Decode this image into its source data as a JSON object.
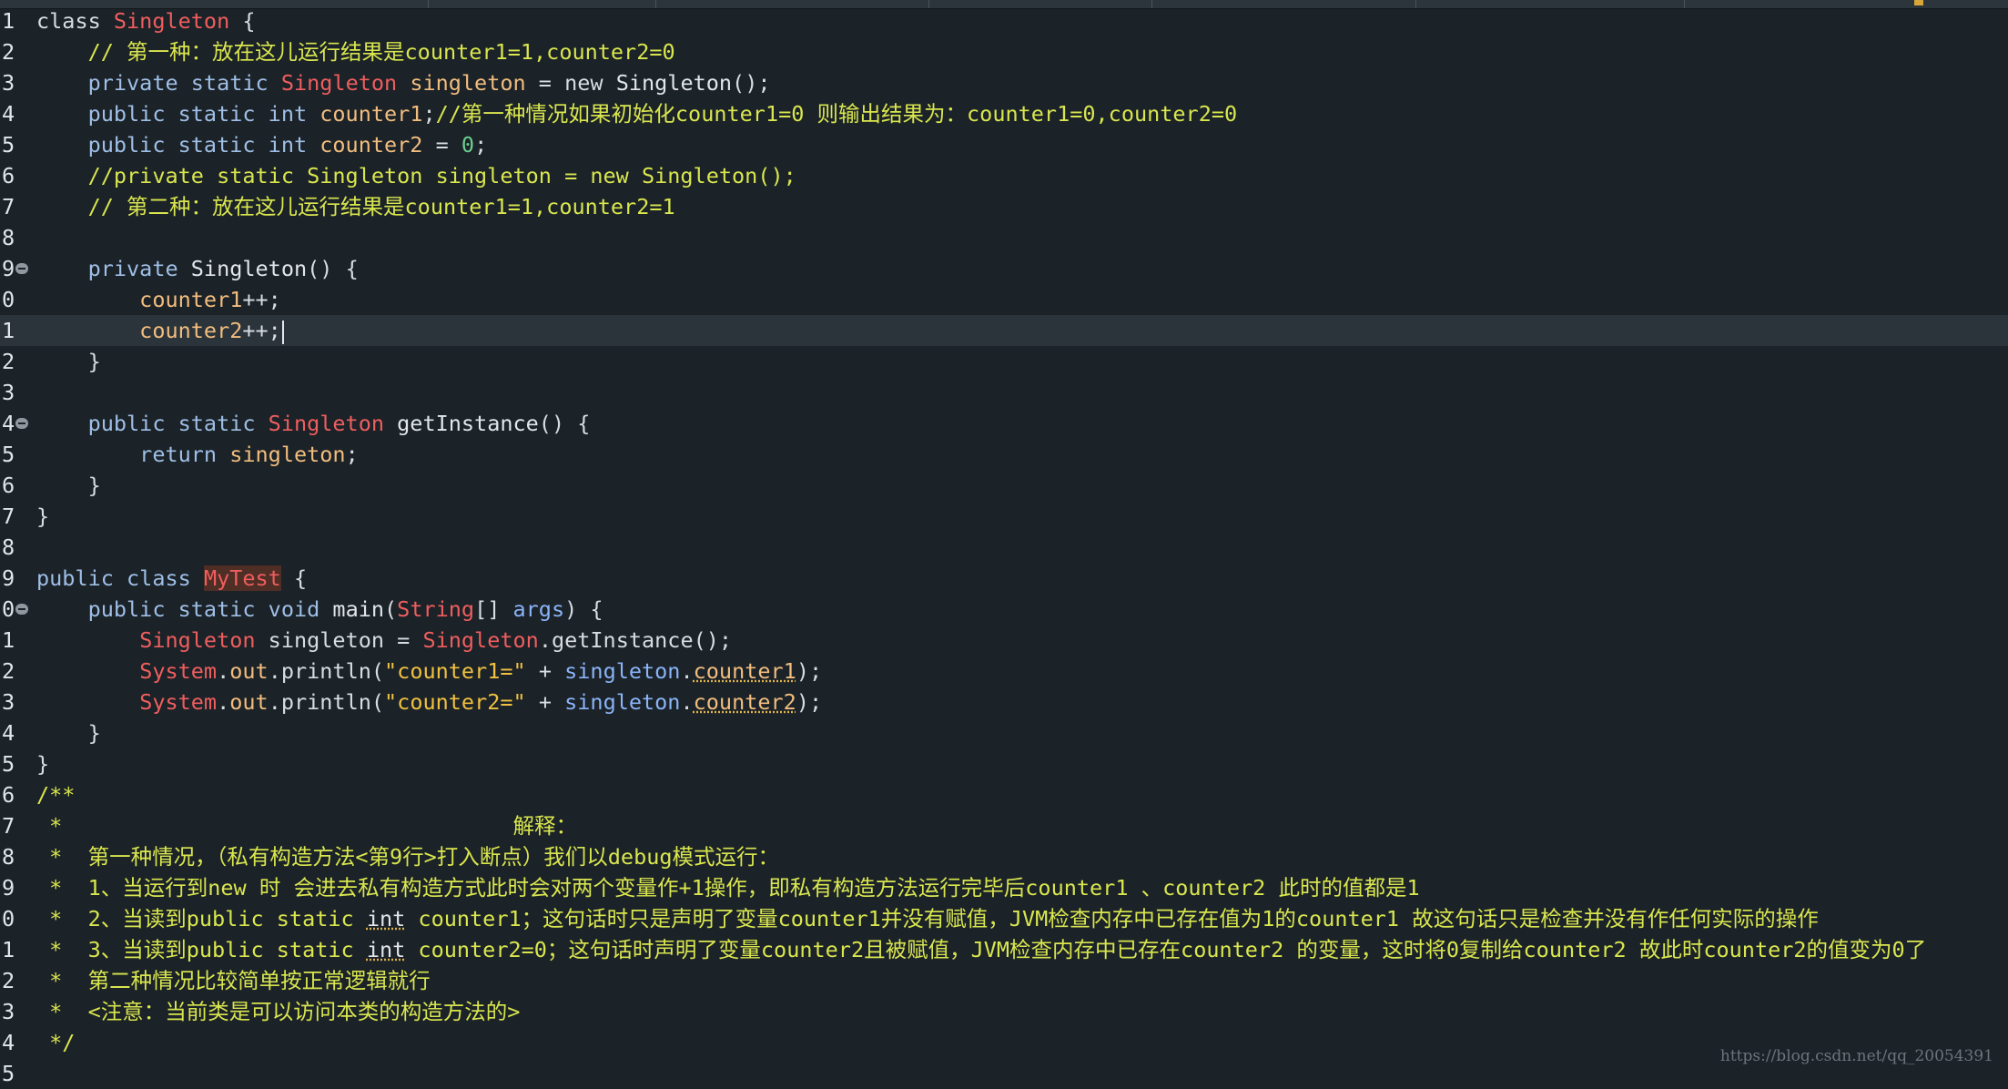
{
  "editor": {
    "lines": [
      {
        "n": "1",
        "tokens": [
          [
            "kw",
            "class "
          ],
          [
            "type",
            "Singleton"
          ],
          [
            "plain",
            " {"
          ]
        ]
      },
      {
        "n": "2",
        "tokens": [
          [
            "comment",
            "    // 第一种：放在这儿运行结果是counter1=1,counter2=0"
          ]
        ]
      },
      {
        "n": "3",
        "tokens": [
          [
            "kw2",
            "    private static "
          ],
          [
            "type",
            "Singleton"
          ],
          [
            "field",
            " singleton"
          ],
          [
            "plain",
            " = "
          ],
          [
            "kw",
            "new "
          ],
          [
            "type2",
            "Singleton"
          ],
          [
            "plain",
            "();"
          ]
        ]
      },
      {
        "n": "4",
        "tokens": [
          [
            "kw2",
            "    public static int "
          ],
          [
            "field",
            "counter1"
          ],
          [
            "plain",
            ";"
          ],
          [
            "comment",
            "//第一种情况如果初始化counter1=0 则输出结果为：counter1=0,counter2=0"
          ]
        ]
      },
      {
        "n": "5",
        "tokens": [
          [
            "kw2",
            "    public static int "
          ],
          [
            "field",
            "counter2"
          ],
          [
            "plain",
            " = "
          ],
          [
            "num",
            "0"
          ],
          [
            "plain",
            ";"
          ]
        ]
      },
      {
        "n": "6",
        "tokens": [
          [
            "comment",
            "    //private static Singleton singleton = new Singleton();"
          ]
        ]
      },
      {
        "n": "7",
        "tokens": [
          [
            "comment",
            "    // 第二种：放在这儿运行结果是counter1=1,counter2=1"
          ]
        ]
      },
      {
        "n": "8",
        "tokens": []
      },
      {
        "n": "9",
        "fold": true,
        "tokens": [
          [
            "kw2",
            "    private "
          ],
          [
            "type2",
            "Singleton"
          ],
          [
            "plain",
            "() {"
          ]
        ]
      },
      {
        "n": "0",
        "tokens": [
          [
            "field",
            "        counter1"
          ],
          [
            "plain",
            "++;"
          ]
        ]
      },
      {
        "n": "1",
        "current": true,
        "cursor": true,
        "tokens": [
          [
            "field",
            "        counter2"
          ],
          [
            "plain",
            "++;"
          ]
        ]
      },
      {
        "n": "2",
        "tokens": [
          [
            "plain",
            "    }"
          ]
        ]
      },
      {
        "n": "3",
        "tokens": []
      },
      {
        "n": "4",
        "fold": true,
        "tokens": [
          [
            "kw2",
            "    public static "
          ],
          [
            "type",
            "Singleton"
          ],
          [
            "method",
            " getInstance"
          ],
          [
            "plain",
            "() {"
          ]
        ]
      },
      {
        "n": "5",
        "tokens": [
          [
            "kw2",
            "        return "
          ],
          [
            "field",
            "singleton"
          ],
          [
            "plain",
            ";"
          ]
        ]
      },
      {
        "n": "6",
        "tokens": [
          [
            "plain",
            "    }"
          ]
        ]
      },
      {
        "n": "7",
        "tokens": [
          [
            "plain",
            "}"
          ]
        ]
      },
      {
        "n": "8",
        "tokens": []
      },
      {
        "n": "9",
        "tokens": [
          [
            "kw2",
            "public class "
          ],
          [
            "hl",
            "MyTest"
          ],
          [
            "plain",
            " {"
          ]
        ]
      },
      {
        "n": "0",
        "fold": true,
        "tokens": [
          [
            "kw2",
            "    public static void "
          ],
          [
            "method",
            "main"
          ],
          [
            "plain",
            "("
          ],
          [
            "type",
            "String"
          ],
          [
            "plain",
            "[] "
          ],
          [
            "local",
            "args"
          ],
          [
            "plain",
            ") {"
          ]
        ]
      },
      {
        "n": "1",
        "tokens": [
          [
            "plain",
            "        "
          ],
          [
            "type",
            "Singleton"
          ],
          [
            "plain",
            " singleton = "
          ],
          [
            "type",
            "Singleton"
          ],
          [
            "plain",
            ".getInstance();"
          ]
        ]
      },
      {
        "n": "2",
        "tokens": [
          [
            "plain",
            "        "
          ],
          [
            "type",
            "System"
          ],
          [
            "plain",
            "."
          ],
          [
            "field",
            "out"
          ],
          [
            "plain",
            ".println("
          ],
          [
            "string",
            "\"counter1=\""
          ],
          [
            "plain",
            " + "
          ],
          [
            "local",
            "singleton"
          ],
          [
            "plain",
            "."
          ],
          [
            "warn",
            "counter1"
          ],
          [
            "plain",
            ");"
          ]
        ]
      },
      {
        "n": "3",
        "tokens": [
          [
            "plain",
            "        "
          ],
          [
            "type",
            "System"
          ],
          [
            "plain",
            "."
          ],
          [
            "field",
            "out"
          ],
          [
            "plain",
            ".println("
          ],
          [
            "string",
            "\"counter2=\""
          ],
          [
            "plain",
            " + "
          ],
          [
            "local",
            "singleton"
          ],
          [
            "plain",
            "."
          ],
          [
            "warn",
            "counter2"
          ],
          [
            "plain",
            ");"
          ]
        ]
      },
      {
        "n": "4",
        "tokens": [
          [
            "plain",
            "    }"
          ]
        ]
      },
      {
        "n": "5",
        "tokens": [
          [
            "plain",
            "}"
          ]
        ]
      },
      {
        "n": "6",
        "tokens": [
          [
            "comment",
            "/**"
          ]
        ]
      },
      {
        "n": "7",
        "tokens": [
          [
            "comment",
            " *                                   解释："
          ]
        ]
      },
      {
        "n": "8",
        "tokens": [
          [
            "comment",
            " *  第一种情况，（私有构造方法<第9行>打入断点）我们以debug模式运行："
          ]
        ]
      },
      {
        "n": "9",
        "tokens": [
          [
            "comment",
            " *  1、当运行到new 时 会进去私有构造方式此时会对两个变量作+1操作，即私有构造方法运行完毕后counter1 、counter2 此时的值都是1"
          ]
        ]
      },
      {
        "n": "0",
        "tokens": [
          [
            "comment",
            " *  2、当读到public static "
          ],
          [
            "uwarn",
            "int"
          ],
          [
            "comment",
            " counter1；这句话时只是声明了变量counter1并没有赋值，JVM检查内存中已存在值为1的counter1 故这句话只是检查并没有作任何实际的操作"
          ]
        ]
      },
      {
        "n": "1",
        "tokens": [
          [
            "comment",
            " *  3、当读到public static "
          ],
          [
            "uwarn",
            "int"
          ],
          [
            "comment",
            " counter2=0；这句话时声明了变量counter2且被赋值，JVM检查内存中已存在counter2 的变量，这时将0复制给counter2 故此时counter2的值变为0了"
          ]
        ]
      },
      {
        "n": "2",
        "tokens": [
          [
            "comment",
            " *  第二种情况比较简单按正常逻辑就行"
          ]
        ]
      },
      {
        "n": "3",
        "tokens": [
          [
            "comment",
            " *  <注意：当前类是可以访问本类的构造方法的>"
          ]
        ]
      },
      {
        "n": "4",
        "tokens": [
          [
            "comment",
            " */"
          ]
        ]
      },
      {
        "n": "5",
        "tokens": []
      }
    ]
  },
  "watermark": "https://blog.csdn.net/qq_20054391"
}
